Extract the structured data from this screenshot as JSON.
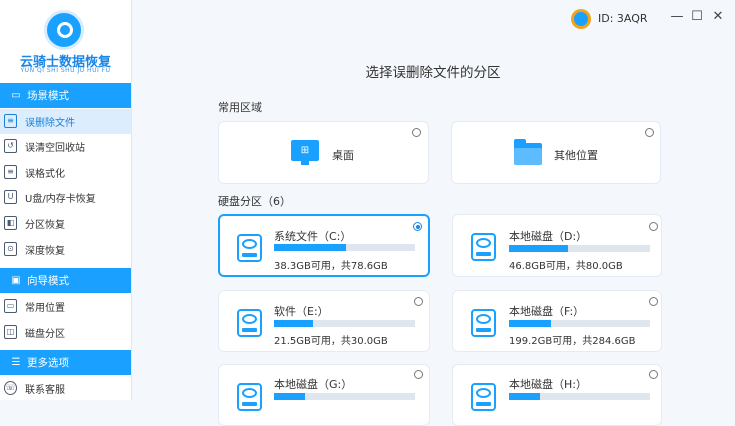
{
  "app": {
    "title": "云骑士数据恢复",
    "subtitle": "YUN QI SHI SHU JU HUI FU",
    "user_id": "ID: 3AQR",
    "accent": "#1aa1ff"
  },
  "window_buttons": [
    "—",
    "☐",
    "✕"
  ],
  "sidebar": {
    "sections": [
      {
        "label": "场景模式",
        "icon": "scene-icon",
        "items": [
          {
            "label": "误删除文件",
            "icon": "file-icon",
            "active": true
          },
          {
            "label": "误清空回收站",
            "icon": "recycle-bin-icon",
            "active": false
          },
          {
            "label": "误格式化",
            "icon": "format-icon",
            "active": false
          },
          {
            "label": "U盘/内存卡恢复",
            "icon": "usb-icon",
            "active": false
          },
          {
            "label": "分区恢复",
            "icon": "partition-icon",
            "active": false
          },
          {
            "label": "深度恢复",
            "icon": "deep-scan-icon",
            "active": false
          }
        ]
      },
      {
        "label": "向导模式",
        "icon": "wizard-icon",
        "items": [
          {
            "label": "常用位置",
            "icon": "location-icon",
            "active": false
          },
          {
            "label": "磁盘分区",
            "icon": "disk-partition-icon",
            "active": false
          }
        ]
      },
      {
        "label": "更多选项",
        "icon": "menu-icon",
        "items": [
          {
            "label": "联系客服",
            "icon": "support-icon",
            "active": false
          }
        ]
      }
    ]
  },
  "main": {
    "title": "选择误删除文件的分区",
    "common_label": "常用区域",
    "common": [
      {
        "label": "桌面",
        "icon": "desktop-icon"
      },
      {
        "label": "其他位置",
        "icon": "folder-icon"
      }
    ],
    "partitions_label": "硬盘分区（6）",
    "partitions": [
      {
        "name": "系统文件（C:）",
        "size": "38.3GB可用，共78.6GB",
        "usage": 0.51,
        "selected": true
      },
      {
        "name": "本地磁盘（D:）",
        "size": "46.8GB可用，共80.0GB",
        "usage": 0.42,
        "selected": false
      },
      {
        "name": "软件（E:）",
        "size": "21.5GB可用，共30.0GB",
        "usage": 0.28,
        "selected": false
      },
      {
        "name": "本地磁盘（F:）",
        "size": "199.2GB可用，共284.6GB",
        "usage": 0.3,
        "selected": false
      },
      {
        "name": "本地磁盘（G:）",
        "size": "",
        "usage": 0.22,
        "selected": false
      },
      {
        "name": "本地磁盘（H:）",
        "size": "",
        "usage": 0.22,
        "selected": false
      }
    ]
  }
}
